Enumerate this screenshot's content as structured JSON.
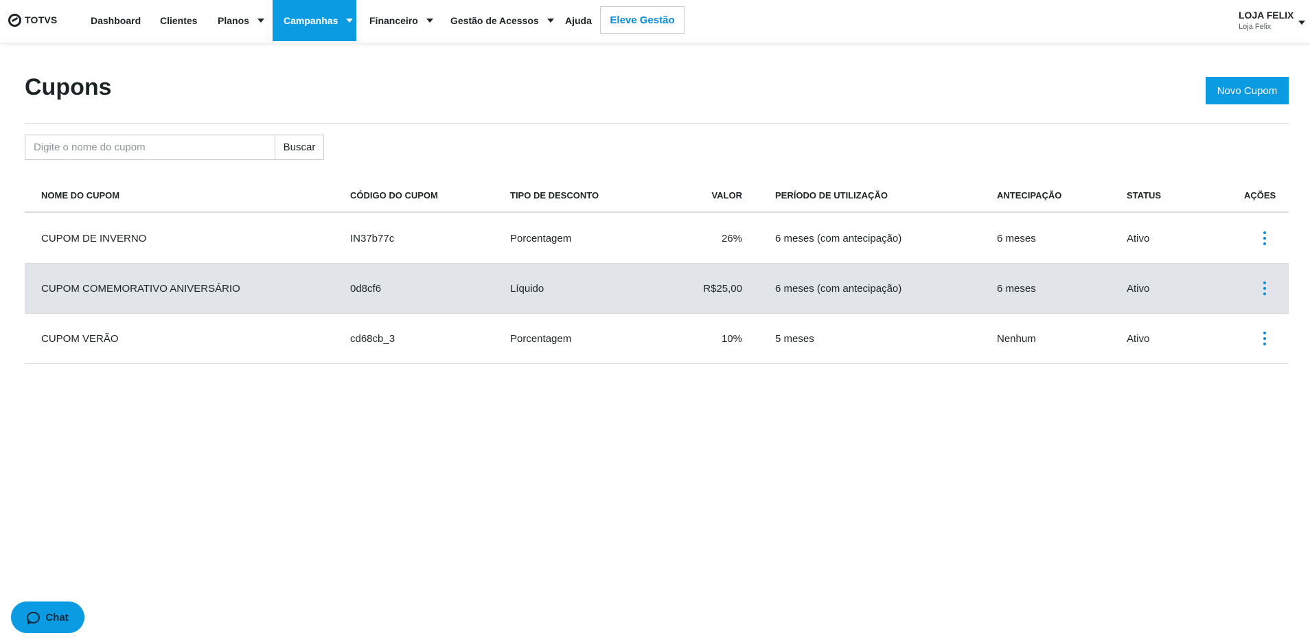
{
  "brand": {
    "logo_text": "TOTVS"
  },
  "nav": {
    "items": [
      {
        "label": "Dashboard",
        "has_caret": false
      },
      {
        "label": "Clientes",
        "has_caret": false
      },
      {
        "label": "Planos",
        "has_caret": true
      },
      {
        "label": "Campanhas",
        "has_caret": true,
        "active": true
      },
      {
        "label": "Financeiro",
        "has_caret": true
      },
      {
        "label": "Gestão de Acessos",
        "has_caret": true
      },
      {
        "label": "Ajuda",
        "has_caret": false
      }
    ],
    "cta_label": "Eleve Gestão"
  },
  "user": {
    "name": "LOJA FELIX",
    "subtitle": "Loja Felix"
  },
  "page": {
    "title": "Cupons",
    "new_button_label": "Novo Cupom"
  },
  "search": {
    "placeholder": "Digite o nome do cupom",
    "value": "",
    "button_label": "Buscar"
  },
  "table": {
    "headers": {
      "name": "NOME DO CUPOM",
      "code": "CÓDIGO DO CUPOM",
      "type": "TIPO DE DESCONTO",
      "value": "VALOR",
      "period": "PERÍODO DE UTILIZAÇÃO",
      "anticipation": "ANTECIPAÇÃO",
      "status": "STATUS",
      "actions": "AÇÕES"
    },
    "rows": [
      {
        "name": "CUPOM DE INVERNO",
        "code": "IN37b77c",
        "type": "Porcentagem",
        "value": "26%",
        "period": "6 meses (com antecipação)",
        "anticipation": "6 meses",
        "status": "Ativo"
      },
      {
        "name": "CUPOM COMEMORATIVO ANIVERSÁRIO",
        "code": "0d8cf6",
        "type": "Líquido",
        "value": "R$25,00",
        "period": "6 meses (com antecipação)",
        "anticipation": "6 meses",
        "status": "Ativo",
        "highlighted": true
      },
      {
        "name": "CUPOM VERÃO",
        "code": "cd68cb_3",
        "type": "Porcentagem",
        "value": "10%",
        "period": "5 meses",
        "anticipation": "Nenhum",
        "status": "Ativo"
      }
    ]
  },
  "chat": {
    "label": "Chat",
    "icon": "chat-bubble-icon"
  },
  "colors": {
    "primary": "#0b9be3",
    "link": "#0b8cd8",
    "text": "#1d2426",
    "row_highlight": "#e1e4e8"
  }
}
